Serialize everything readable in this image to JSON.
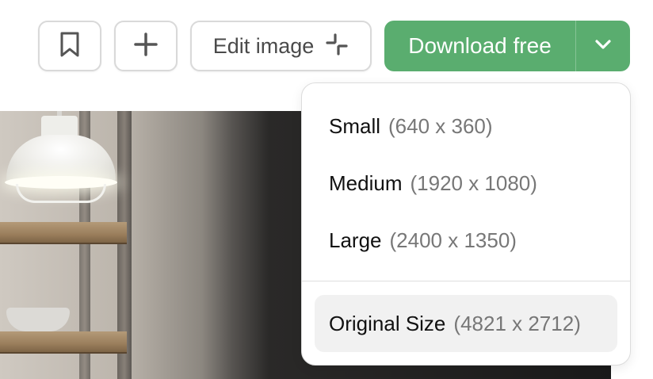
{
  "toolbar": {
    "bookmark_icon": "bookmark-icon",
    "add_icon": "plus-icon",
    "edit_label": "Edit image",
    "edit_icon": "crop-sparkle-icon",
    "download_label": "Download free",
    "download_caret_icon": "chevron-down-icon",
    "download_color": "#5aad6f"
  },
  "menu": {
    "items": [
      {
        "name": "Small",
        "dims": "(640 x 360)"
      },
      {
        "name": "Medium",
        "dims": "(1920 x 1080)"
      },
      {
        "name": "Large",
        "dims": "(2400 x 1350)"
      },
      {
        "name": "Original Size",
        "dims": "(4821 x 2712)"
      }
    ]
  }
}
